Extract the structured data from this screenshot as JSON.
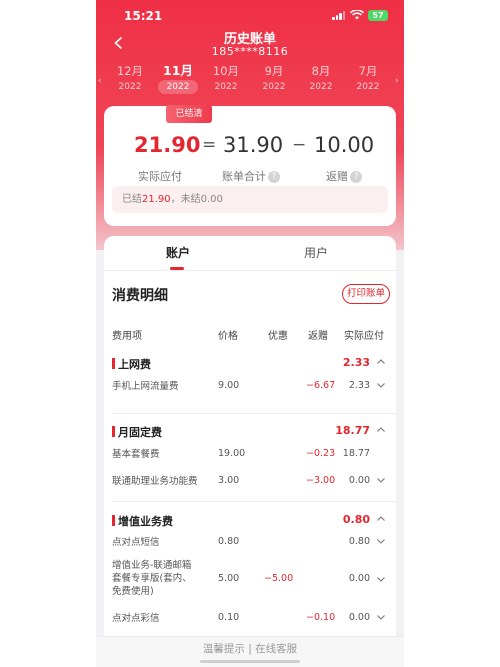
{
  "status": {
    "time": "15:21",
    "battery": "57"
  },
  "header": {
    "title": "历史账单",
    "phone": "185****8116"
  },
  "months": [
    {
      "m": "12月",
      "y": "2022",
      "active": false
    },
    {
      "m": "11月",
      "y": "2022",
      "active": true
    },
    {
      "m": "10月",
      "y": "2022",
      "active": false
    },
    {
      "m": "9月",
      "y": "2022",
      "active": false
    },
    {
      "m": "8月",
      "y": "2022",
      "active": false
    },
    {
      "m": "7月",
      "y": "2022",
      "active": false
    }
  ],
  "summary": {
    "settled_tag": "已结清",
    "actual": "21.90",
    "equals": "=",
    "total": "31.90",
    "minus": "−",
    "gift": "10.00",
    "actual_label": "实际应付",
    "total_label": "账单合计",
    "gift_label": "返赠",
    "settled_prefix": "已结",
    "settled_value": "21.90",
    "unsettled_text": "，未结0.00"
  },
  "tabs": {
    "account": "账户",
    "user": "用户"
  },
  "detail": {
    "title": "消费明细",
    "print": "打印账单",
    "headers": {
      "name": "费用项",
      "price": "价格",
      "discount": "优惠",
      "gift": "返赠",
      "pay": "实际应付"
    }
  },
  "groups": [
    {
      "name": "上网费",
      "total": "2.33"
    },
    {
      "name": "月固定费",
      "total": "18.77"
    },
    {
      "name": "增值业务费",
      "total": "0.80"
    }
  ],
  "rows": [
    {
      "name": "手机上网流量费",
      "price": "9.00",
      "discount": "",
      "gift": "−6.67",
      "pay": "2.33"
    },
    {
      "name": "基本套餐费",
      "price": "19.00",
      "discount": "",
      "gift": "−0.23",
      "pay": "18.77"
    },
    {
      "name": "联通助理业务功能费",
      "price": "3.00",
      "discount": "",
      "gift": "−3.00",
      "pay": "0.00"
    },
    {
      "name": "点对点短信",
      "price": "0.80",
      "discount": "",
      "gift": "",
      "pay": "0.80"
    },
    {
      "name": "增值业务-联通邮箱套餐专享版(套内、免费使用)",
      "price": "5.00",
      "discount": "−5.00",
      "gift": "",
      "pay": "0.00"
    },
    {
      "name": "点对点彩信",
      "price": "0.10",
      "discount": "",
      "gift": "−0.10",
      "pay": "0.00"
    }
  ],
  "footer": {
    "tip": "温馨提示",
    "divider": "|",
    "service": "在线客服"
  },
  "colors": {
    "accent": "#e4262f",
    "header_red": "#ef2f45"
  },
  "icons": [
    "back-arrow-icon",
    "chevron-up-icon",
    "chevron-down-icon",
    "question-icon",
    "signal-icon",
    "wifi-icon",
    "battery-icon"
  ]
}
